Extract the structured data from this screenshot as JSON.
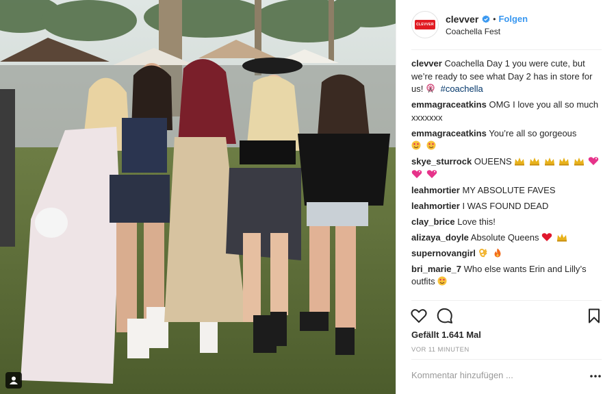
{
  "post": {
    "username": "clevver",
    "follow_label": "Folgen",
    "location": "Coachella Fest",
    "logo_text": "CLEVVER"
  },
  "caption": {
    "username": "clevver",
    "text": "Coachella Day 1 you were cute, but we’re ready to see what Day 2 has in store for us!",
    "hashtag": "#coachella"
  },
  "comments": [
    {
      "user": "emmagraceatkins",
      "text": "OMG I love you all so much xxxxxxx",
      "emojis": []
    },
    {
      "user": "emmagraceatkins",
      "text": "You’re all so gorgeous",
      "emojis": [
        "heart-eyes-emoji",
        "heart-eyes-emoji"
      ]
    },
    {
      "user": "skye_sturrock",
      "text": "OUEENS",
      "emojis": [
        "crown-emoji",
        "crown-emoji",
        "crown-emoji",
        "crown-emoji",
        "crown-emoji",
        "sparkling-heart-emoji",
        "sparkling-heart-emoji",
        "sparkling-heart-emoji"
      ]
    },
    {
      "user": "leahmortier",
      "text": "MY ABSOLUTE FAVES",
      "emojis": []
    },
    {
      "user": "leahmortier",
      "text": "I WAS FOUND DEAD",
      "emojis": []
    },
    {
      "user": "clay_brice",
      "text": "Love this!",
      "emojis": []
    },
    {
      "user": "alizaya_doyle",
      "text": "Absolute Queens",
      "emojis": [
        "red-heart-emoji",
        "crown-emoji"
      ]
    },
    {
      "user": "supernovangirl",
      "text": "",
      "emojis": [
        "ok-hand-emoji",
        "fire-emoji"
      ]
    },
    {
      "user": "bri_marie_7",
      "text": "Who else wants Erin and Lilly’s outfits",
      "emojis": [
        "heart-eyes-emoji"
      ]
    }
  ],
  "likes": "Gefällt 1.641 Mal",
  "timestamp": "VOR 11 MINUTEN",
  "add_comment_placeholder": "Kommentar hinzufügen ...",
  "colors": {
    "link": "#3897f0",
    "text": "#262626",
    "muted": "#999999",
    "brand": "#e11b22"
  }
}
